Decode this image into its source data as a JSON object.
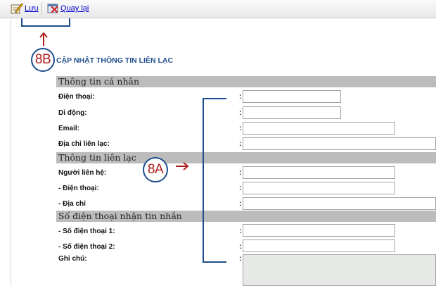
{
  "toolbar": {
    "save_label": "Lưu",
    "back_label": "Quay lại",
    "save_icon": "save-pencil-icon",
    "back_icon": "back-cross-icon"
  },
  "annotations": {
    "label_8b": "8B",
    "label_8a": "8A",
    "accent_color": "#1f4e8c",
    "arrow_color": "#b01c1c"
  },
  "page": {
    "title": "CẬP NHẬT THÔNG TIN LIÊN LẠC"
  },
  "sections": {
    "personal": {
      "title": "Thông tin cá nhân",
      "phone_label": "Điện thoại:",
      "phone_value": "",
      "mobile_label": "Di động:",
      "mobile_value": "",
      "email_label": "Email:",
      "email_value": "",
      "address_label": "Địa chỉ liên lạc:",
      "address_value": ""
    },
    "contact": {
      "title": "Thông tin liên lạc",
      "person_label": "Người liên hệ:",
      "person_value": "",
      "phone_label": "- Điện thoại:",
      "phone_value": "",
      "address_label": "- Địa chỉ",
      "address_value": ""
    },
    "sms": {
      "title": "Số điện thoại nhận tin nhắn",
      "phone1_label": "- Số điện thoại 1:",
      "phone1_value": "",
      "phone2_label": "- Số điện thoại 2:",
      "phone2_value": "",
      "note_label": "Ghi chú:",
      "note_value": ""
    }
  },
  "colon": ":"
}
